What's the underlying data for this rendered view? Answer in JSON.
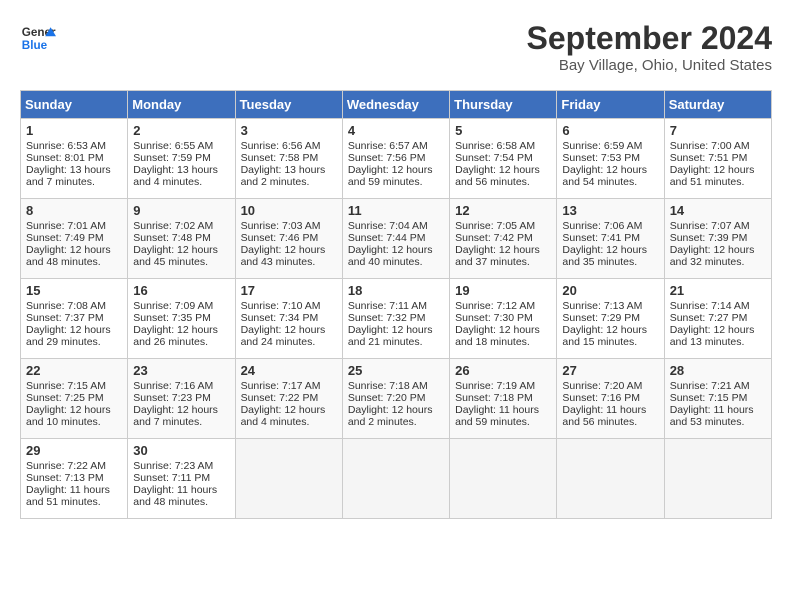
{
  "logo": {
    "line1": "General",
    "line2": "Blue"
  },
  "title": "September 2024",
  "location": "Bay Village, Ohio, United States",
  "days_header": [
    "Sunday",
    "Monday",
    "Tuesday",
    "Wednesday",
    "Thursday",
    "Friday",
    "Saturday"
  ],
  "weeks": [
    [
      {
        "day": "1",
        "sunrise": "6:53 AM",
        "sunset": "8:01 PM",
        "daylight": "13 hours and 7 minutes."
      },
      {
        "day": "2",
        "sunrise": "6:55 AM",
        "sunset": "7:59 PM",
        "daylight": "13 hours and 4 minutes."
      },
      {
        "day": "3",
        "sunrise": "6:56 AM",
        "sunset": "7:58 PM",
        "daylight": "13 hours and 2 minutes."
      },
      {
        "day": "4",
        "sunrise": "6:57 AM",
        "sunset": "7:56 PM",
        "daylight": "12 hours and 59 minutes."
      },
      {
        "day": "5",
        "sunrise": "6:58 AM",
        "sunset": "7:54 PM",
        "daylight": "12 hours and 56 minutes."
      },
      {
        "day": "6",
        "sunrise": "6:59 AM",
        "sunset": "7:53 PM",
        "daylight": "12 hours and 54 minutes."
      },
      {
        "day": "7",
        "sunrise": "7:00 AM",
        "sunset": "7:51 PM",
        "daylight": "12 hours and 51 minutes."
      }
    ],
    [
      {
        "day": "8",
        "sunrise": "7:01 AM",
        "sunset": "7:49 PM",
        "daylight": "12 hours and 48 minutes."
      },
      {
        "day": "9",
        "sunrise": "7:02 AM",
        "sunset": "7:48 PM",
        "daylight": "12 hours and 45 minutes."
      },
      {
        "day": "10",
        "sunrise": "7:03 AM",
        "sunset": "7:46 PM",
        "daylight": "12 hours and 43 minutes."
      },
      {
        "day": "11",
        "sunrise": "7:04 AM",
        "sunset": "7:44 PM",
        "daylight": "12 hours and 40 minutes."
      },
      {
        "day": "12",
        "sunrise": "7:05 AM",
        "sunset": "7:42 PM",
        "daylight": "12 hours and 37 minutes."
      },
      {
        "day": "13",
        "sunrise": "7:06 AM",
        "sunset": "7:41 PM",
        "daylight": "12 hours and 35 minutes."
      },
      {
        "day": "14",
        "sunrise": "7:07 AM",
        "sunset": "7:39 PM",
        "daylight": "12 hours and 32 minutes."
      }
    ],
    [
      {
        "day": "15",
        "sunrise": "7:08 AM",
        "sunset": "7:37 PM",
        "daylight": "12 hours and 29 minutes."
      },
      {
        "day": "16",
        "sunrise": "7:09 AM",
        "sunset": "7:35 PM",
        "daylight": "12 hours and 26 minutes."
      },
      {
        "day": "17",
        "sunrise": "7:10 AM",
        "sunset": "7:34 PM",
        "daylight": "12 hours and 24 minutes."
      },
      {
        "day": "18",
        "sunrise": "7:11 AM",
        "sunset": "7:32 PM",
        "daylight": "12 hours and 21 minutes."
      },
      {
        "day": "19",
        "sunrise": "7:12 AM",
        "sunset": "7:30 PM",
        "daylight": "12 hours and 18 minutes."
      },
      {
        "day": "20",
        "sunrise": "7:13 AM",
        "sunset": "7:29 PM",
        "daylight": "12 hours and 15 minutes."
      },
      {
        "day": "21",
        "sunrise": "7:14 AM",
        "sunset": "7:27 PM",
        "daylight": "12 hours and 13 minutes."
      }
    ],
    [
      {
        "day": "22",
        "sunrise": "7:15 AM",
        "sunset": "7:25 PM",
        "daylight": "12 hours and 10 minutes."
      },
      {
        "day": "23",
        "sunrise": "7:16 AM",
        "sunset": "7:23 PM",
        "daylight": "12 hours and 7 minutes."
      },
      {
        "day": "24",
        "sunrise": "7:17 AM",
        "sunset": "7:22 PM",
        "daylight": "12 hours and 4 minutes."
      },
      {
        "day": "25",
        "sunrise": "7:18 AM",
        "sunset": "7:20 PM",
        "daylight": "12 hours and 2 minutes."
      },
      {
        "day": "26",
        "sunrise": "7:19 AM",
        "sunset": "7:18 PM",
        "daylight": "11 hours and 59 minutes."
      },
      {
        "day": "27",
        "sunrise": "7:20 AM",
        "sunset": "7:16 PM",
        "daylight": "11 hours and 56 minutes."
      },
      {
        "day": "28",
        "sunrise": "7:21 AM",
        "sunset": "7:15 PM",
        "daylight": "11 hours and 53 minutes."
      }
    ],
    [
      {
        "day": "29",
        "sunrise": "7:22 AM",
        "sunset": "7:13 PM",
        "daylight": "11 hours and 51 minutes."
      },
      {
        "day": "30",
        "sunrise": "7:23 AM",
        "sunset": "7:11 PM",
        "daylight": "11 hours and 48 minutes."
      },
      null,
      null,
      null,
      null,
      null
    ]
  ],
  "labels": {
    "sunrise": "Sunrise:",
    "sunset": "Sunset:",
    "daylight": "Daylight:"
  }
}
